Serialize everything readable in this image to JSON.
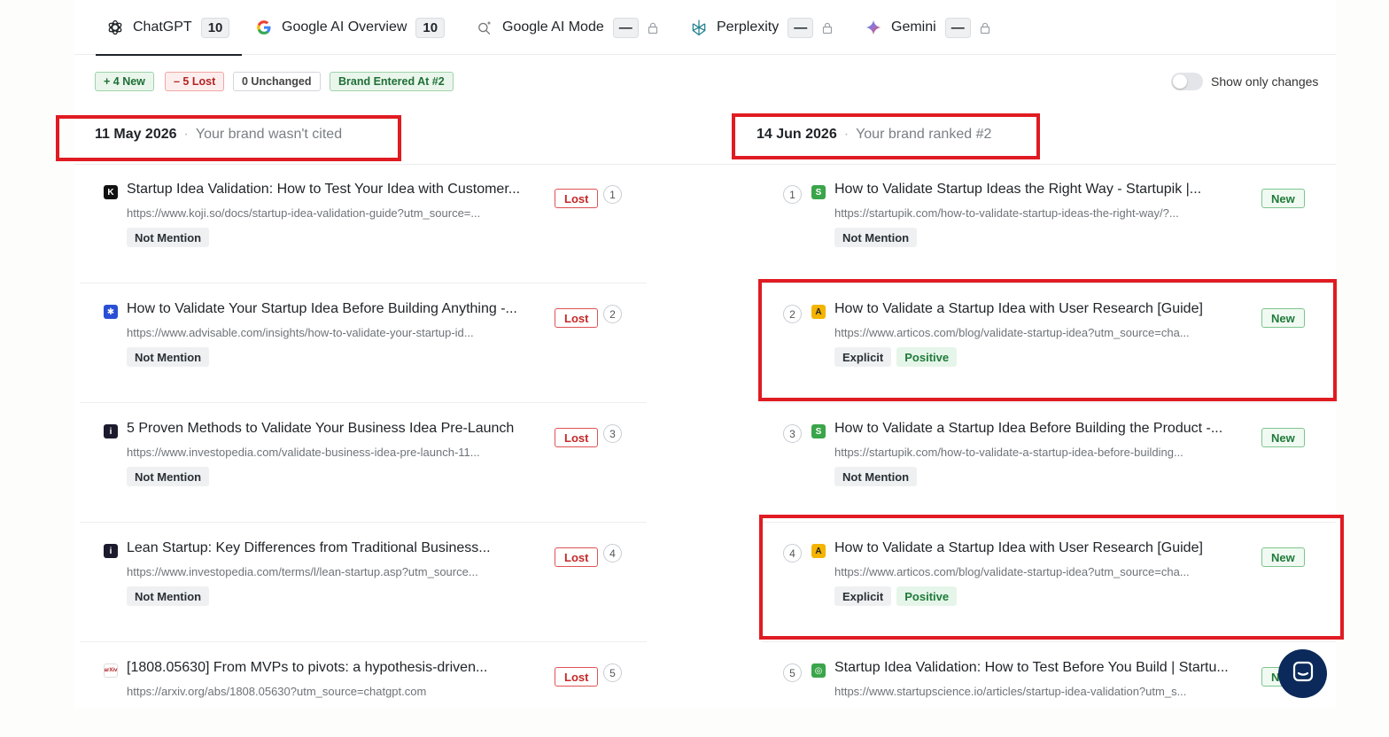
{
  "tabs": [
    {
      "label": "ChatGPT",
      "count": "10",
      "icon": "openai-icon",
      "locked": false,
      "active": true
    },
    {
      "label": "Google AI Overview",
      "count": "10",
      "icon": "google-icon",
      "locked": false,
      "active": false
    },
    {
      "label": "Google AI Mode",
      "count": "—",
      "icon": "search-sparkle-icon",
      "locked": true,
      "active": false
    },
    {
      "label": "Perplexity",
      "count": "—",
      "icon": "perplexity-icon",
      "locked": true,
      "active": false
    },
    {
      "label": "Gemini",
      "count": "—",
      "icon": "gemini-icon",
      "locked": true,
      "active": false
    }
  ],
  "summary": {
    "new": "+ 4 New",
    "lost": "– 5 Lost",
    "unchanged": "0 Unchanged",
    "brand_entered": "Brand Entered At #2",
    "toggle_label": "Show only changes"
  },
  "left": {
    "date": "11 May 2026",
    "subtitle": "Your brand wasn't cited",
    "results": [
      {
        "rank": "1",
        "title": "Startup Idea Validation: How to Test Your Idea with Customer...",
        "url": "https://www.koji.so/docs/startup-idea-validation-guide?utm_source=...",
        "status": "Lost",
        "tags": [
          "Not Mention"
        ],
        "favicon": "K",
        "favicon_color": "#111111"
      },
      {
        "rank": "2",
        "title": "How to Validate Your Startup Idea Before Building Anything -...",
        "url": "https://www.advisable.com/insights/how-to-validate-your-startup-id...",
        "status": "Lost",
        "tags": [
          "Not Mention"
        ],
        "favicon": "✱",
        "favicon_color": "#2a4fd6"
      },
      {
        "rank": "3",
        "title": "5 Proven Methods to Validate Your Business Idea Pre-Launch",
        "url": "https://www.investopedia.com/validate-business-idea-pre-launch-11...",
        "status": "Lost",
        "tags": [
          "Not Mention"
        ],
        "favicon": "i",
        "favicon_color": "#1b1b2e"
      },
      {
        "rank": "4",
        "title": "Lean Startup: Key Differences from Traditional Business...",
        "url": "https://www.investopedia.com/terms/l/lean-startup.asp?utm_source...",
        "status": "Lost",
        "tags": [
          "Not Mention"
        ],
        "favicon": "i",
        "favicon_color": "#1b1b2e"
      },
      {
        "rank": "5",
        "title": "[1808.05630] From MVPs to pivots: a hypothesis-driven...",
        "url": "https://arxiv.org/abs/1808.05630?utm_source=chatgpt.com",
        "status": "Lost",
        "tags": [],
        "favicon": "arXiv",
        "favicon_color": "#ffffff"
      }
    ]
  },
  "right": {
    "date": "14 Jun 2026",
    "subtitle": "Your brand ranked #2",
    "results": [
      {
        "rank": "1",
        "title": "How to Validate Startup Ideas the Right Way - Startupik |...",
        "url": "https://startupik.com/how-to-validate-startup-ideas-the-right-way/?...",
        "status": "New",
        "tags": [
          "Not Mention"
        ],
        "favicon": "S",
        "favicon_color": "#3aa54a"
      },
      {
        "rank": "2",
        "title": "How to Validate a Startup Idea with User Research [Guide]",
        "url": "https://www.articos.com/blog/validate-startup-idea?utm_source=cha...",
        "status": "New",
        "tags": [
          "Explicit",
          "Positive"
        ],
        "favicon": "A",
        "favicon_color": "#f4b400"
      },
      {
        "rank": "3",
        "title": "How to Validate a Startup Idea Before Building the Product -...",
        "url": "https://startupik.com/how-to-validate-a-startup-idea-before-building...",
        "status": "New",
        "tags": [
          "Not Mention"
        ],
        "favicon": "S",
        "favicon_color": "#3aa54a"
      },
      {
        "rank": "4",
        "title": "How to Validate a Startup Idea with User Research [Guide]",
        "url": "https://www.articos.com/blog/validate-startup-idea?utm_source=cha...",
        "status": "New",
        "tags": [
          "Explicit",
          "Positive"
        ],
        "favicon": "A",
        "favicon_color": "#f4b400"
      },
      {
        "rank": "5",
        "title": "Startup Idea Validation: How to Test Before You Build | Startu...",
        "url": "https://www.startupscience.io/articles/startup-idea-validation?utm_s...",
        "status": "New",
        "tags": [],
        "favicon": "◎",
        "favicon_color": "#3aa54a"
      }
    ]
  }
}
